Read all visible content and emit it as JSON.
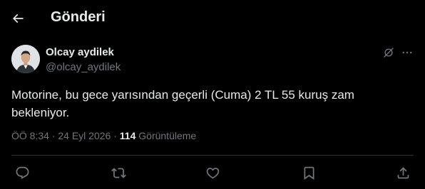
{
  "header": {
    "title": "Gönderi",
    "back_icon": "arrow-left-icon"
  },
  "post": {
    "author_name": "Olcay aydilek",
    "author_handle": "@olcay_aydilek",
    "text": "Motorine, bu gece yarısından geçerli (Cuma) 2 TL 55 kuruş zam bekleniyor.",
    "time": "ÖÖ 8:34",
    "separator": " · ",
    "date": "24 Eyl 2026",
    "views_count": "114",
    "views_label": " Görüntüleme"
  },
  "actions": {
    "icons": [
      "reply-icon",
      "retweet-icon",
      "like-icon",
      "bookmark-icon",
      "share-icon"
    ]
  },
  "colors": {
    "background": "#000000",
    "text": "#e7e9ea",
    "secondary_text": "#71767b",
    "divider": "#2f3336"
  }
}
